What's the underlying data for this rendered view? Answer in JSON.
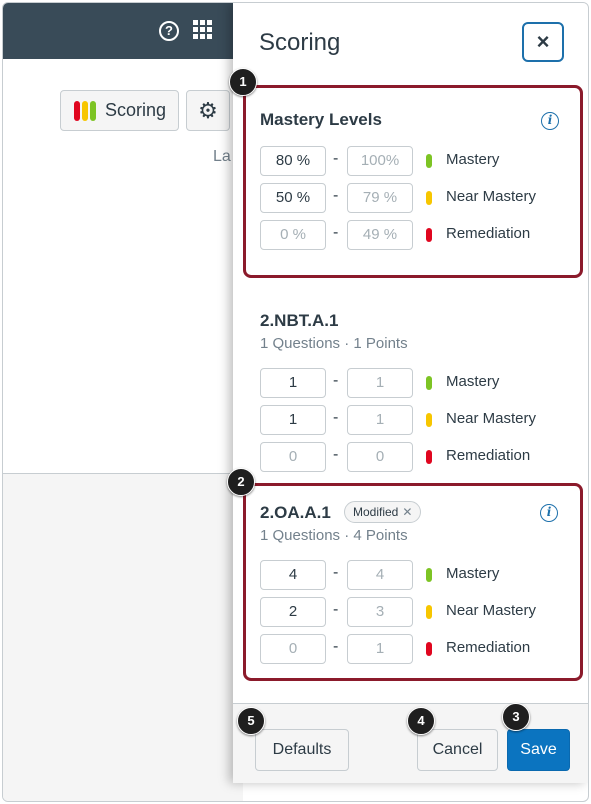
{
  "tray": {
    "title": "Scoring",
    "close_label": "×"
  },
  "background": {
    "scoring_button_label": "Scoring",
    "partial_text": "La",
    "help_icon_glyph": "?"
  },
  "mastery_levels": {
    "title": "Mastery Levels",
    "rows": [
      {
        "min": "80",
        "min_unit": "%",
        "max": "100",
        "max_unit": "%",
        "level": "Mastery",
        "color": "#7dc424"
      },
      {
        "min": "50",
        "min_unit": "%",
        "max": "79",
        "max_unit": "%",
        "level": "Near Mastery",
        "color": "#f7c600"
      },
      {
        "min": "0",
        "min_unit": "%",
        "max": "49",
        "max_unit": "%",
        "level": "Remediation",
        "color": "#e0061f"
      }
    ]
  },
  "standards": [
    {
      "title": "2.NBT.A.1",
      "subtitle": "1 Questions · 1 Points",
      "rows": [
        {
          "min": "1",
          "max": "1",
          "level": "Mastery"
        },
        {
          "min": "1",
          "max": "1",
          "level": "Near Mastery"
        },
        {
          "min": "0",
          "max": "0",
          "level": "Remediation"
        }
      ]
    },
    {
      "title": "2.OA.A.1",
      "badge": "Modified",
      "badge_close": "✕",
      "subtitle": "1 Questions · 4 Points",
      "rows": [
        {
          "min": "4",
          "max": "4",
          "level": "Mastery"
        },
        {
          "min": "2",
          "max": "3",
          "level": "Near Mastery"
        },
        {
          "min": "0",
          "max": "1",
          "level": "Remediation"
        }
      ]
    }
  ],
  "footer": {
    "defaults_label": "Defaults",
    "cancel_label": "Cancel",
    "save_label": "Save"
  },
  "callouts": [
    "1",
    "2",
    "3",
    "4",
    "5"
  ],
  "separator": "-",
  "info_glyph": "i",
  "colors": {
    "mastery": "#7dc424",
    "near_mastery": "#f7c600",
    "remediation": "#e0061f",
    "primary": "#0b74c0",
    "callout_border": "#8b1a2b",
    "topbar": "#394b58"
  }
}
